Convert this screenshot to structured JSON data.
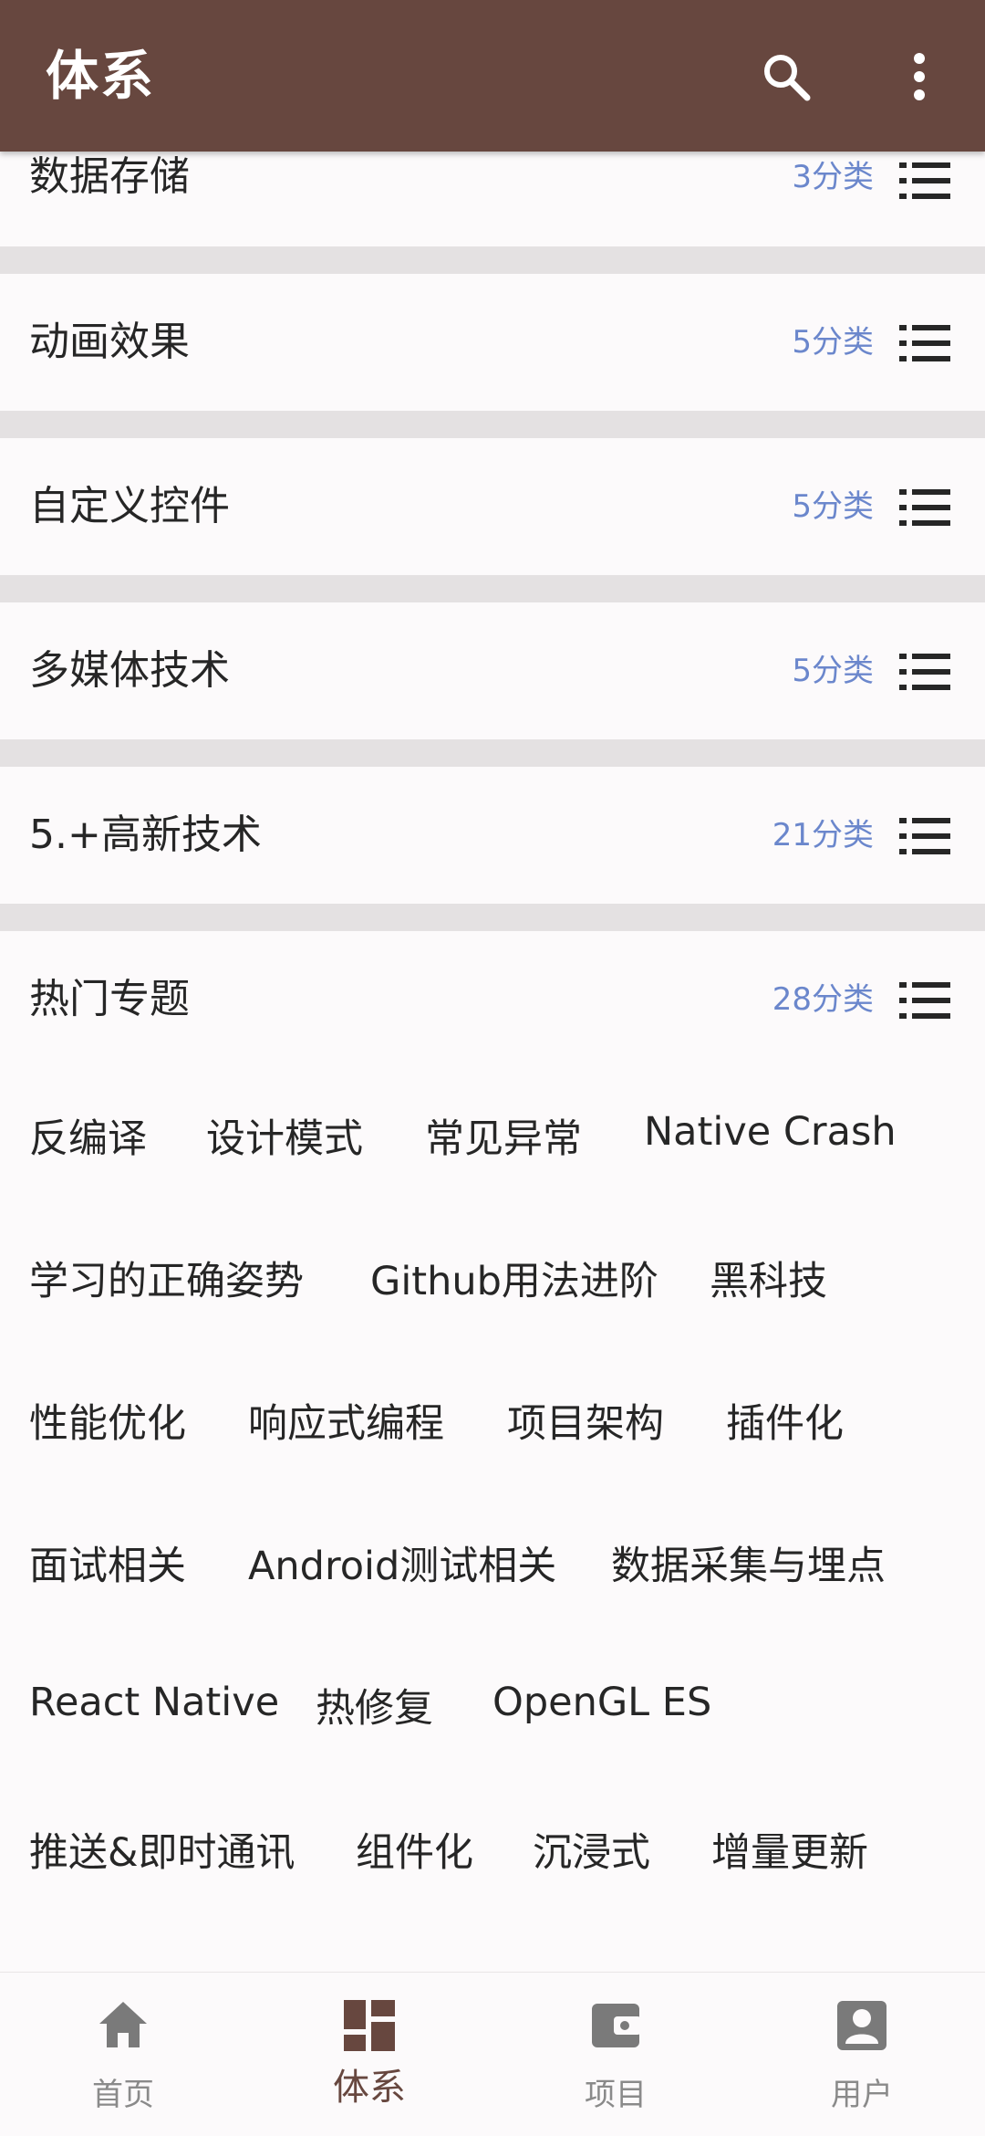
{
  "app": {
    "title": "体系"
  },
  "categories": [
    {
      "name": "数据存储",
      "count": "3分类"
    },
    {
      "name": "动画效果",
      "count": "5分类"
    },
    {
      "name": "自定义控件",
      "count": "5分类"
    },
    {
      "name": "多媒体技术",
      "count": "5分类"
    },
    {
      "name": "5.+高新技术",
      "count": "21分类"
    },
    {
      "name": "热门专题",
      "count": "28分类"
    }
  ],
  "tags": [
    "反编译",
    "设计模式",
    "常见异常",
    "Native Crash",
    "学习的正确姿势",
    "Github用法进阶",
    "黑科技",
    "性能优化",
    "响应式编程",
    "项目架构",
    "插件化",
    "面试相关",
    "Android测试相关",
    "数据采集与埋点",
    "React Native",
    "热修复",
    "OpenGL ES",
    "推送&即时通讯",
    "组件化",
    "沉浸式",
    "增量更新"
  ],
  "bottom_nav": [
    {
      "label": "首页",
      "icon": "home-icon"
    },
    {
      "label": "体系",
      "icon": "system-icon"
    },
    {
      "label": "项目",
      "icon": "project-icon"
    },
    {
      "label": "用户",
      "icon": "user-icon"
    }
  ],
  "colors": {
    "primary": "#67473f",
    "count_text": "#6b87cc",
    "separator": "#e4e1e2",
    "background": "#fcfafb",
    "nav_inactive": "#8a8a8a"
  }
}
